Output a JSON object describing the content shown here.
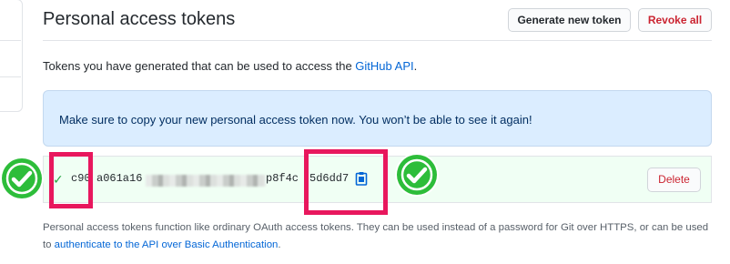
{
  "header": {
    "title": "Personal access tokens",
    "generate_label": "Generate new token",
    "revoke_label": "Revoke all"
  },
  "intro": {
    "text": "Tokens you have generated that can be used to access the ",
    "link": "GitHub API",
    "suffix": "."
  },
  "flash": {
    "message": "Make sure to copy your new personal access token now. You won’t be able to see it again!"
  },
  "token": {
    "check_glyph": "✓",
    "prefix": "c90",
    "partial": "a061a16",
    "suffix": "p8f4c",
    "tail": "5d6dd7",
    "delete_label": "Delete",
    "copy_icon": "clipboard-icon",
    "status_color": "#28a745"
  },
  "footnote": {
    "text": "Personal access tokens function like ordinary OAuth access tokens. They can be used instead of a password for Git over HTTPS, or can be used to ",
    "link": "authenticate to the API over Basic Authentication",
    "suffix": "."
  },
  "annotations": {
    "highlight_color": "#e8175d",
    "badge_color": "#2dbd3a",
    "badge_icon": "check-circle-icon"
  }
}
